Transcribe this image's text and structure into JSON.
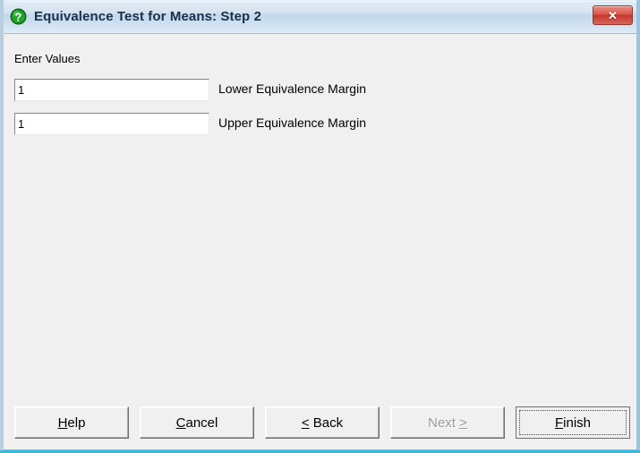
{
  "window": {
    "title": "Equivalence Test for Means: Step 2",
    "title_icon": "help-question-icon",
    "close_label": "✕",
    "colors": {
      "titlebar_text": "#1b2f4a",
      "client_background": "#f0f0f0",
      "frame_accent": "#39b8dd",
      "close_button": "#c8352c",
      "help_icon_green": "#1a8a1a"
    }
  },
  "main": {
    "section_label": "Enter Values",
    "fields": [
      {
        "name": "lower-equivalence-margin",
        "value": "1",
        "placeholder": "",
        "label": "Lower Equivalence Margin"
      },
      {
        "name": "upper-equivalence-margin",
        "value": "1",
        "placeholder": "",
        "label": "Upper Equivalence Margin"
      }
    ]
  },
  "buttons": {
    "help": {
      "label": "Help",
      "mnemonic": "H",
      "before": "",
      "after": "elp",
      "enabled": true
    },
    "cancel": {
      "label": "Cancel",
      "mnemonic": "C",
      "before": "",
      "after": "ancel",
      "enabled": true
    },
    "back": {
      "label": "< Back",
      "mnemonic": "<",
      "before": "",
      "after": " Back",
      "enabled": true
    },
    "next": {
      "label": "Next >",
      "mnemonic": ">",
      "before": "Next ",
      "after": "",
      "enabled": false
    },
    "finish": {
      "label": "Finish",
      "mnemonic": "F",
      "before": "",
      "after": "inish",
      "enabled": true,
      "is_default": true,
      "focused": true
    }
  }
}
